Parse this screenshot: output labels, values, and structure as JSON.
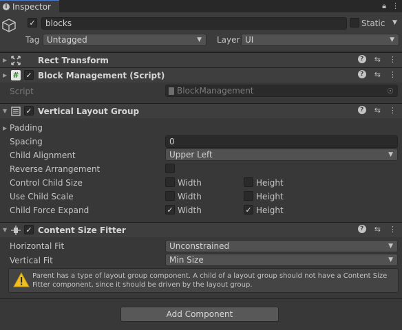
{
  "tab": {
    "title": "Inspector"
  },
  "header": {
    "name": "blocks",
    "static_label": "Static",
    "tag_label": "Tag",
    "tag_value": "Untagged",
    "layer_label": "Layer",
    "layer_value": "UI"
  },
  "components": {
    "rect_transform": {
      "title": "Rect Transform"
    },
    "block_management": {
      "title": "Block Management (Script)",
      "script_label": "Script",
      "script_value": "BlockManagement"
    },
    "vertical_layout_group": {
      "title": "Vertical Layout Group",
      "padding_label": "Padding",
      "spacing_label": "Spacing",
      "spacing_value": "0",
      "child_alignment_label": "Child Alignment",
      "child_alignment_value": "Upper Left",
      "reverse_arrangement_label": "Reverse Arrangement",
      "control_child_size_label": "Control Child Size",
      "use_child_scale_label": "Use Child Scale",
      "child_force_expand_label": "Child Force Expand",
      "width_label": "Width",
      "height_label": "Height"
    },
    "content_size_fitter": {
      "title": "Content Size Fitter",
      "horizontal_fit_label": "Horizontal Fit",
      "horizontal_fit_value": "Unconstrained",
      "vertical_fit_label": "Vertical Fit",
      "vertical_fit_value": "Min Size",
      "warning_text": "Parent has a type of layout group component. A child of a layout group should not have a Content Size Fitter component, since it should be driven by the layout group."
    }
  },
  "add_component_label": "Add Component",
  "colors": {
    "background": "#383838",
    "header": "#3e3e3e",
    "field": "#2a2a2a",
    "warning": "#f0c020"
  }
}
